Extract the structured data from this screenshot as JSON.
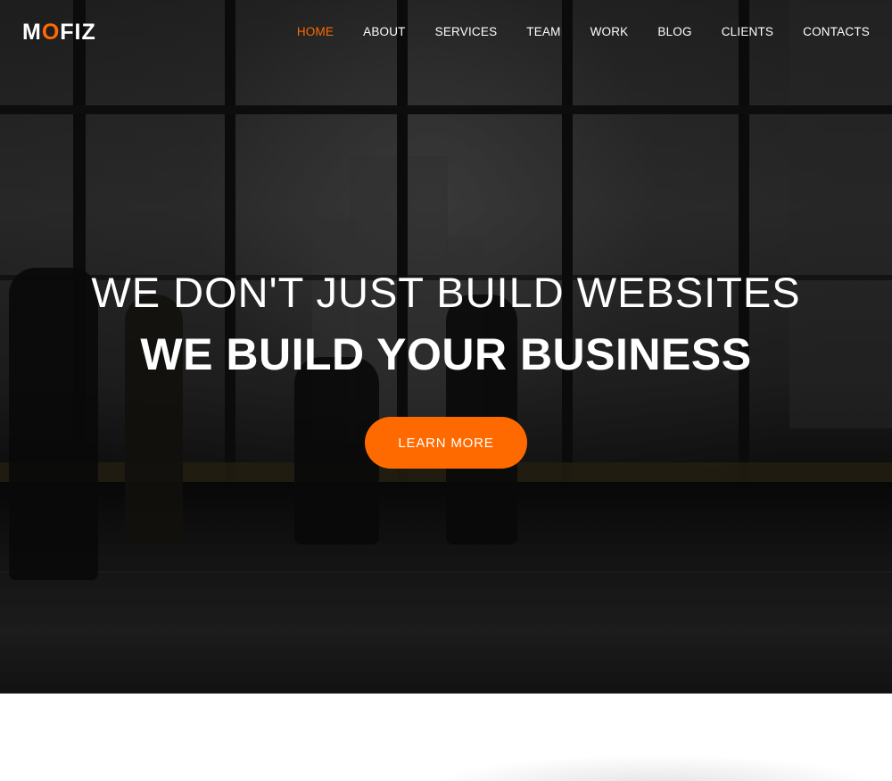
{
  "header": {
    "logo": {
      "prefix": "M",
      "accent": "O",
      "suffix": "FIZ"
    },
    "nav": [
      {
        "label": "HOME",
        "active": true
      },
      {
        "label": "ABOUT",
        "active": false
      },
      {
        "label": "SERVICES",
        "active": false
      },
      {
        "label": "TEAM",
        "active": false
      },
      {
        "label": "WORK",
        "active": false
      },
      {
        "label": "BLOG",
        "active": false
      },
      {
        "label": "CLIENTS",
        "active": false
      },
      {
        "label": "CONTACTS",
        "active": false
      }
    ]
  },
  "hero": {
    "headline": "WE DON'T JUST BUILD WEBSITES",
    "subheadline": "WE BUILD YOUR BUSINESS",
    "cta_label": "LEARN MORE"
  },
  "colors": {
    "accent": "#ff6a00",
    "text": "#ffffff",
    "background_below": "#ffffff"
  }
}
